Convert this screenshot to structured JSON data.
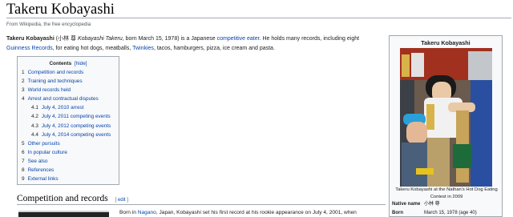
{
  "page": {
    "title": "Takeru Kobayashi",
    "tagline": "From Wikipedia, the free encyclopedia"
  },
  "lead": {
    "name": "Takeru Kobayashi",
    "p1": " (小林 尊 ",
    "romaji": "Kobayashi Takeru",
    "p2": ", born March 15, 1978) is a Japanese ",
    "link1": "competitive eater",
    "p3": ". He holds many records, including eight",
    "link2": "Guinness Records",
    "p4": ", for eating hot dogs, meatballs, ",
    "link3": "Twinkies",
    "p5": ", tacos, hamburgers, pizza, ice cream and pasta."
  },
  "toc": {
    "title": "Contents",
    "hide": "[hide]",
    "items": [
      {
        "num": "1",
        "label": "Competition and records",
        "sub": false
      },
      {
        "num": "2",
        "label": "Training and techniques",
        "sub": false
      },
      {
        "num": "3",
        "label": "World records held",
        "sub": false
      },
      {
        "num": "4",
        "label": "Arrest and contractual disputes",
        "sub": false
      },
      {
        "num": "4.1",
        "label": "July 4, 2010 arrest",
        "sub": true
      },
      {
        "num": "4.2",
        "label": "July 4, 2011 competing events",
        "sub": true
      },
      {
        "num": "4.3",
        "label": "July 4, 2012 competing events",
        "sub": true
      },
      {
        "num": "4.4",
        "label": "July 4, 2014 competing events",
        "sub": true
      },
      {
        "num": "5",
        "label": "Other pursuits",
        "sub": false
      },
      {
        "num": "6",
        "label": "In popular culture",
        "sub": false
      },
      {
        "num": "7",
        "label": "See also",
        "sub": false
      },
      {
        "num": "8",
        "label": "References",
        "sub": false
      },
      {
        "num": "9",
        "label": "External links",
        "sub": false
      }
    ]
  },
  "section": {
    "heading": "Competition and records",
    "edit_open": "[ ",
    "edit_label": "edit",
    "edit_close": " ]",
    "text_prefix": "Born in ",
    "text_link": "Nagano",
    "text_rest": ", Japan, Kobayashi set his first record at his rookie appearance on July 4, 2001, when"
  },
  "infobox": {
    "title": "Takeru Kobayashi",
    "caption": "Takeru Kobayashi at the Nathan's Hot Dog Eating Contest in 2009",
    "native_name_key": "Native name",
    "native_name_val": "小林 尊",
    "born_key": "Born",
    "born_val": "March 15, 1978 (age 40)"
  },
  "colors": {
    "link": "#0645ad",
    "text": "#202122",
    "border": "#a2a9b1",
    "box_bg": "#f8f9fa"
  }
}
